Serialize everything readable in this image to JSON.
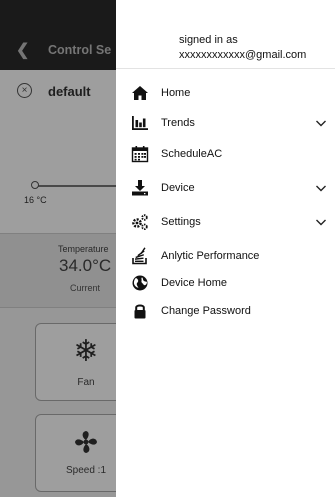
{
  "app": {
    "title": "Control Se",
    "profile_name": "default",
    "slider_min_label": "16 °C",
    "temperature": {
      "label": "Temperature",
      "value": "34.0°C",
      "caption": "Current"
    },
    "tiles": [
      {
        "label": "Fan",
        "icon": "snowflake-icon"
      },
      {
        "label": "Speed :1",
        "icon": "fan-icon"
      }
    ]
  },
  "drawer": {
    "signed_in_line1": "signed in as",
    "signed_in_line2": "xxxxxxxxxxxx@gmail.com",
    "menu": [
      {
        "label": "Home",
        "icon": "home-icon",
        "expandable": false
      },
      {
        "label": "Trends",
        "icon": "bar-chart-icon",
        "expandable": true
      },
      {
        "label": "ScheduleAC",
        "icon": "calendar-icon",
        "expandable": false
      },
      {
        "label": "Device",
        "icon": "download-icon",
        "expandable": true
      },
      {
        "label": "Settings",
        "icon": "gears-icon",
        "expandable": true
      },
      {
        "label": "Anlytic Performance",
        "icon": "stack-icon",
        "expandable": false
      },
      {
        "label": "Device Home",
        "icon": "globe-icon",
        "expandable": false
      },
      {
        "label": "Change Password",
        "icon": "lock-icon",
        "expandable": false
      }
    ]
  }
}
